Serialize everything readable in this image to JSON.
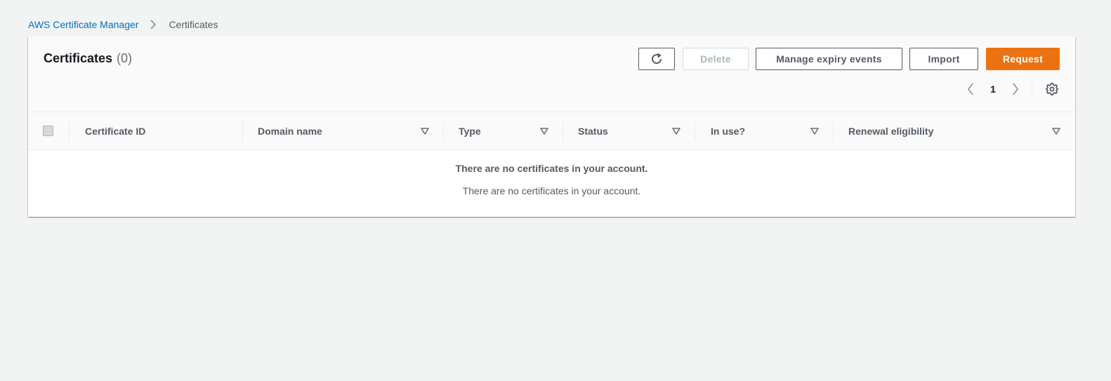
{
  "breadcrumb": {
    "root": "AWS Certificate Manager",
    "current": "Certificates"
  },
  "panel": {
    "title": "Certificates",
    "count": "(0)"
  },
  "actions": {
    "delete": "Delete",
    "manage_expiry": "Manage expiry events",
    "import": "Import",
    "request": "Request"
  },
  "pagination": {
    "current_page": "1"
  },
  "table": {
    "columns": [
      "Certificate ID",
      "Domain name",
      "Type",
      "Status",
      "In use?",
      "Renewal eligibility"
    ],
    "rows": [],
    "empty_title": "There are no certificates in your account.",
    "empty_description": "There are no certificates in your account."
  },
  "colors": {
    "accent": "#ec7211",
    "link": "#0073bb",
    "background": "#f2f3f3"
  },
  "icons": {
    "breadcrumb_separator": "chevron-right-icon",
    "refresh": "refresh-icon",
    "prev": "chevron-left-icon",
    "next": "chevron-right-icon",
    "settings": "gear-icon",
    "sort": "caret-down-icon"
  }
}
